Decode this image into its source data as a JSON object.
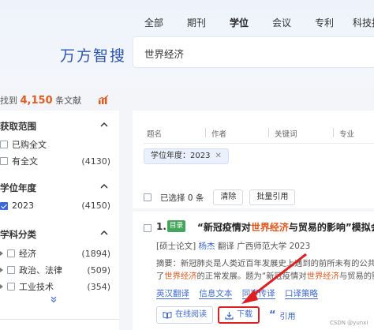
{
  "header": {
    "tabs": [
      {
        "label": "全部"
      },
      {
        "label": "期刊"
      },
      {
        "label": "学位"
      },
      {
        "label": "会议"
      },
      {
        "label": "专利"
      },
      {
        "label": "科技报"
      }
    ],
    "active_tab": "学位",
    "logo": "万方智搜",
    "search_value": "世界经济"
  },
  "results_summary": {
    "prefix": "找到",
    "count": "4,150",
    "suffix": "条文献"
  },
  "sidebar": {
    "access": {
      "title": "获取范围",
      "options": [
        {
          "label": "已购全文",
          "count": "",
          "checked": false
        },
        {
          "label": "有全文",
          "count": "(4130)",
          "checked": false
        }
      ]
    },
    "year": {
      "title": "学位年度",
      "options": [
        {
          "label": "2023",
          "count": "(4150)",
          "checked": true
        }
      ]
    },
    "subject": {
      "title": "学科分类",
      "options": [
        {
          "label": "经济",
          "count": "(1894)"
        },
        {
          "label": "政治、法律",
          "count": "(509)"
        },
        {
          "label": "工业技术",
          "count": "(354)"
        }
      ]
    }
  },
  "search_fields": [
    "题名",
    "作者",
    "关键词",
    "专业"
  ],
  "active_filter": "学位年度：2023",
  "selection": {
    "selected_text": "已选择 0 条",
    "clear_label": "清除",
    "batch_cite_label": "批量引用"
  },
  "result": {
    "number": "1.",
    "badge": "目录",
    "title_pre": "“新冠疫情对",
    "title_hl": "世界经济",
    "title_post": "与贸易的影响”模拟会议",
    "type": "[硕士论文]",
    "author": "杨杰",
    "meta_rest": "翻译 广西师范大学 2023",
    "abstract_line1": "摘要：新冠肺炎是人类近百年发展史上遇到的前所未有的公共卫生",
    "abstract_line2_pre": "了",
    "abstract_line2_hl1": "世界经济",
    "abstract_line2_mid": "的正常发展。题为“新冠疫情对",
    "abstract_line2_hl2": "世界经济",
    "abstract_line2_post": "与贸易的影响",
    "keywords": [
      "英汉翻译",
      "信息文本",
      "同声传译",
      "口译策略"
    ],
    "actions": {
      "read_online": "在线阅读",
      "download": "下载",
      "cite": "引用"
    }
  },
  "annotation": {
    "arrow_color": "#e02020"
  },
  "watermark": "CSDN @yunxi"
}
